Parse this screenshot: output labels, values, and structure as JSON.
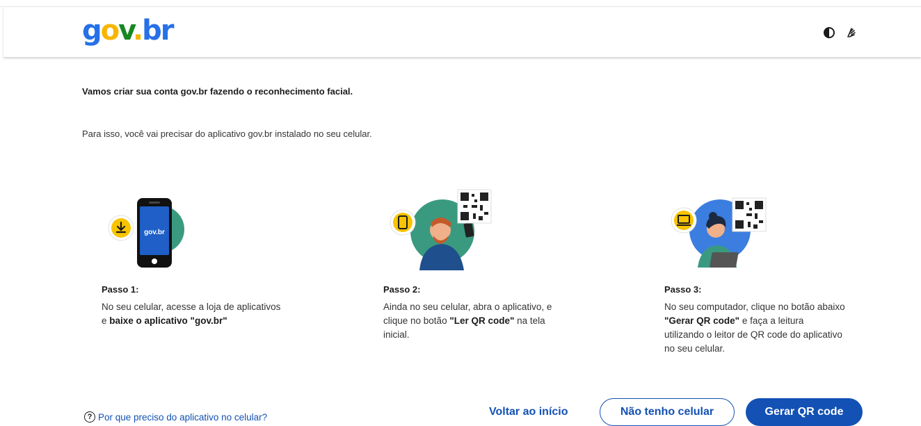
{
  "header": {
    "logo": {
      "g": "g",
      "o": "o",
      "v": "v",
      "dot": ".",
      "br": "br"
    },
    "icons": [
      "contrast-icon",
      "hand-sign-icon"
    ]
  },
  "intro": {
    "line1": "Vamos criar sua conta gov.br fazendo o reconhecimento facial.",
    "line2": "Para isso, você vai precisar do aplicativo gov.br instalado no seu celular."
  },
  "steps": [
    {
      "title": "Passo 1:",
      "desc_pre": "No seu celular, acesse a loja de aplicativos e ",
      "desc_bold": "baixe o aplicativo \"gov.br\"",
      "desc_post": "",
      "phone_label": "gov.br"
    },
    {
      "title": "Passo 2:",
      "desc_pre": "Ainda no seu celular, abra o aplicativo, e clique no botão ",
      "desc_bold": "\"Ler QR code\"",
      "desc_post": " na tela inicial."
    },
    {
      "title": "Passo 3:",
      "desc_pre": "No seu computador, clique no botão abaixo ",
      "desc_bold": "\"Gerar QR code\"",
      "desc_post": " e faça a leitura utilizando o leitor de QR code do aplicativo no seu celular."
    }
  ],
  "footer": {
    "help_label": "Por que preciso do aplicativo no celular?",
    "back_label": "Voltar ao início",
    "no_phone_label": "Não tenho celular",
    "generate_label": "Gerar QR code"
  },
  "colors": {
    "primary": "#1351b4",
    "logo_blue": "#2670e8",
    "logo_yellow": "#f8b500",
    "logo_green": "#168821",
    "teal_circle": "#3a9a80",
    "blue_circle": "#3b7ee0"
  }
}
